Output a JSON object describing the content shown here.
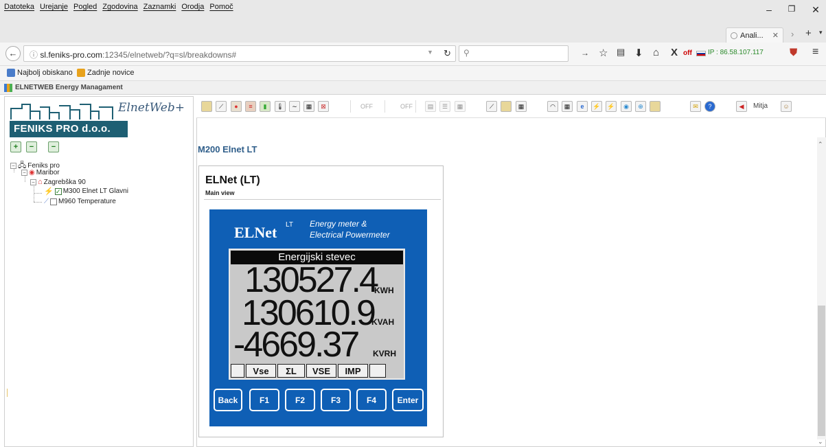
{
  "menubar": {
    "items": [
      "Datoteka",
      "Urejanje",
      "Pogled",
      "Zgodovina",
      "Zaznamki",
      "Orodja",
      "Pomoč"
    ]
  },
  "tab": {
    "label": "Anali...",
    "close": "✕"
  },
  "navbar": {
    "url_domain": "sl.feniks-pro.com",
    "url_rest": ":12345/elnetweb/?q=sl/breakdowns#",
    "ip_label": "IP : 86.58.107.117",
    "off_label": "off"
  },
  "bookmarks": [
    "Najbolj obiskano",
    "Zadnje novice"
  ],
  "app": {
    "title": "ELNETWEB Energy Managament",
    "logo_script": "ElnetWeb+",
    "brand": "FENIKS PRO d.o.o."
  },
  "tree": {
    "root": "Feniks pro",
    "city": "Maribor",
    "address": "Zagrebška 90",
    "device1": "M300 Elnet LT Glavni",
    "device2": "M960 Temperature"
  },
  "toolbar": {
    "off1": "OFF",
    "off2": "OFF",
    "user": "Mitja"
  },
  "main": {
    "device_title": "M200 Elnet LT",
    "card_title": "ELNet (LT)",
    "card_subtitle": "Main view"
  },
  "meter": {
    "brand": "ELNet",
    "brand_sup": "LT",
    "tagline1": "Energy meter &",
    "tagline2": "Electrical Powermeter",
    "lcd_header": "Energijski stevec",
    "reading1": "130527.4",
    "unit1": "KWH",
    "reading2": "130610.9",
    "unit2": "KVAH",
    "reading3": "-4669.37",
    "unit3": "KVRH",
    "softkeys": [
      "Vse",
      "ΣL",
      "VSE",
      "IMP"
    ],
    "buttons": [
      "Back",
      "F1",
      "F2",
      "F3",
      "F4",
      "Enter"
    ]
  },
  "colors": {
    "meter_blue": "#0f5fb5",
    "brand_teal": "#1e5f73",
    "title_blue": "#2f5e8a"
  }
}
